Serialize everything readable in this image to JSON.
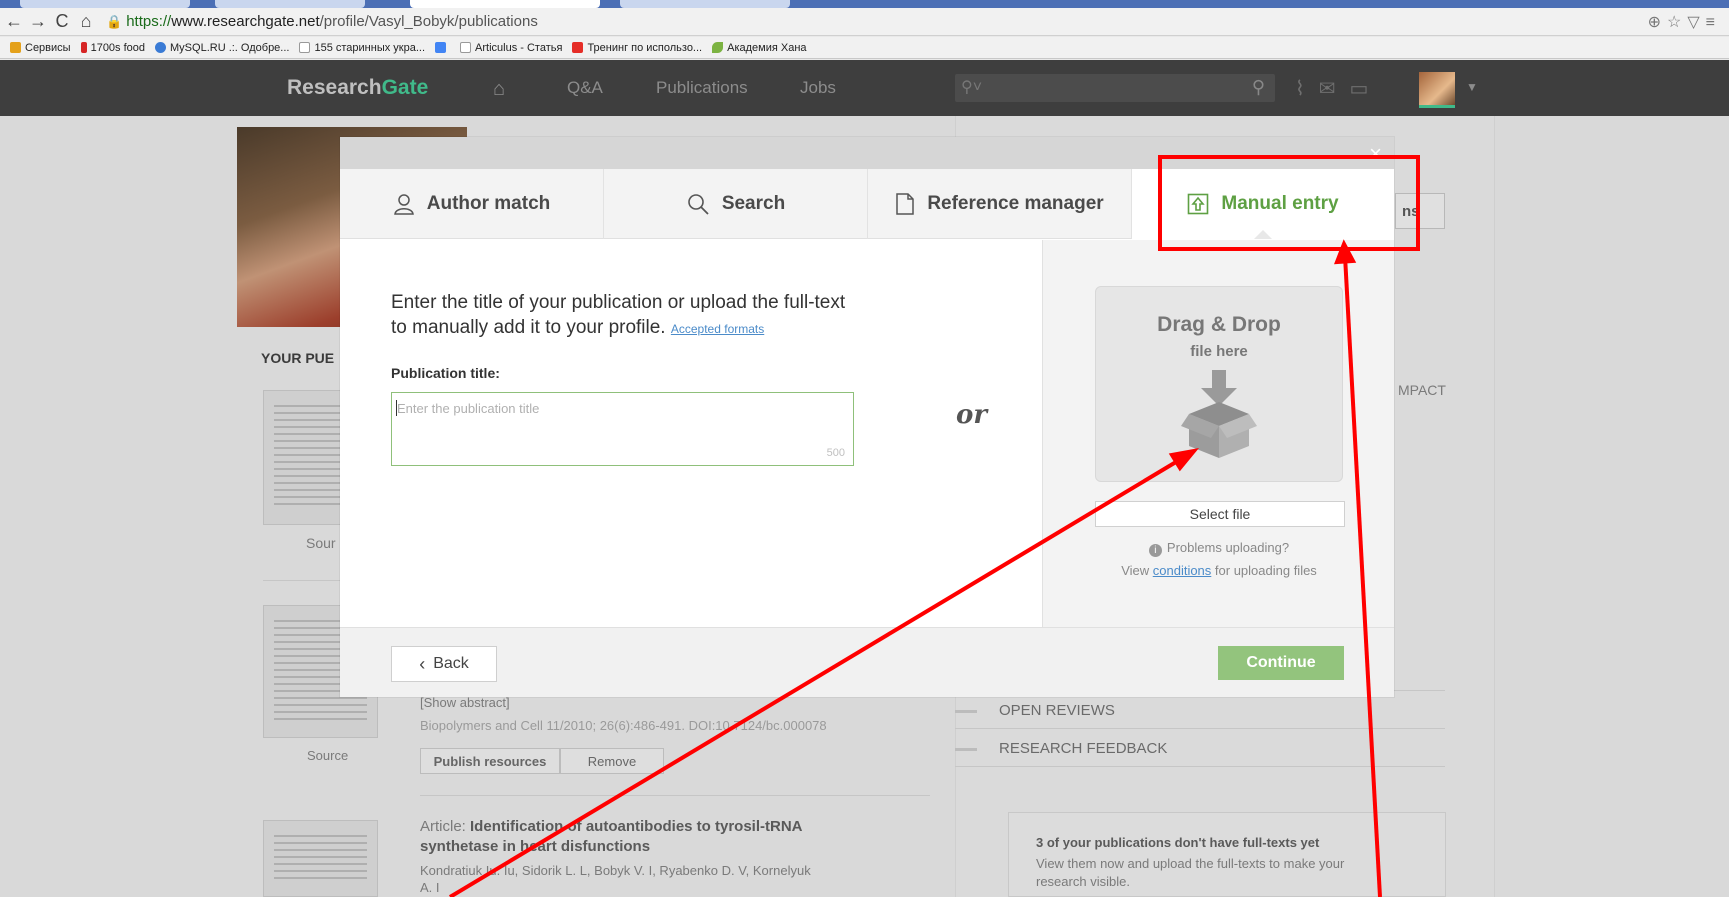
{
  "browser": {
    "url_scheme": "https://",
    "url_host": "www.researchgate.net",
    "url_path": "/profile/Vasyl_Bobyk/publications",
    "bookmarks": [
      {
        "label": "Сервисы",
        "color": "#e4a11b"
      },
      {
        "label": "1700s food",
        "color": "#d62525"
      },
      {
        "label": "MySQL.RU .:. Одобре...",
        "color": "#3a7bd5"
      },
      {
        "label": "155 старинных укра...",
        "color": "#bbbbbb"
      },
      {
        "label": "",
        "color": "#4285f4"
      },
      {
        "label": "Articulus - Статья",
        "color": "#bbbbbb"
      },
      {
        "label": "Тренинг по использо...",
        "color": "#e52d27"
      },
      {
        "label": "Академия Хана",
        "color": "#7cb342"
      }
    ]
  },
  "rg_nav": {
    "logo_research": "Research",
    "logo_gate": "Gate",
    "qa": "Q&A",
    "publications": "Publications",
    "jobs": "Jobs",
    "colors": {
      "bar": "#3e3e3e",
      "gate_green": "#40ba8a"
    }
  },
  "background": {
    "your_publications": "YOUR PUE",
    "source_1": "Sour",
    "source_2": "Source",
    "show_abstract": "[Show abstract]",
    "citation": "Biopolymers and Cell 11/2010; 26(6):486-491. DOI:10.7124/bc.000078",
    "publish_resources": "Publish resources",
    "remove": "Remove",
    "article_prefix": "Article: ",
    "article_title_1": "Identification of autoantibodies to tyrosil-tRNA",
    "article_title_2": "synthetase in heart disfunctions",
    "authors_1": "Kondratiuk Iu. Iu, Sidorik L. L, Bobyk V. I, Ryabenko D. V, Kornelyuk",
    "authors_2": "A. I",
    "impact_partial": "MPACT",
    "open_reviews": "OPEN REVIEWS",
    "research_feedback": "RESEARCH FEEDBACK",
    "fulltext_title": "3 of your publications don't have full-texts yet",
    "fulltext_desc_1": "View them now and upload the full-texts to make your",
    "fulltext_desc_2": "research visible.",
    "partial_button": "ns"
  },
  "modal": {
    "tabs": [
      {
        "label": "Author match",
        "icon": "person-icon"
      },
      {
        "label": "Search",
        "icon": "search-icon"
      },
      {
        "label": "Reference manager",
        "icon": "document-icon"
      },
      {
        "label": "Manual entry",
        "icon": "upload-icon",
        "active": true
      }
    ],
    "intro_line_1": "Enter the title of your publication or upload the full-text",
    "intro_line_2": "to manually add it to your profile.",
    "accepted_formats": "Accepted formats",
    "field_label": "Publication title:",
    "title_placeholder": "Enter the publication title",
    "char_count": "500",
    "or": "or",
    "dropzone_title": "Drag & Drop",
    "dropzone_sub": "file here",
    "select_file": "Select file",
    "problems_uploading": "Problems uploading?",
    "conditions_prefix": "View ",
    "conditions_link": "conditions",
    "conditions_suffix": " for uploading files",
    "back": "Back",
    "continue": "Continue",
    "colors": {
      "active_green": "#5ea043",
      "continue_bg": "#93c47d"
    }
  },
  "annotations": {
    "highlight_color": "#ff0000"
  }
}
